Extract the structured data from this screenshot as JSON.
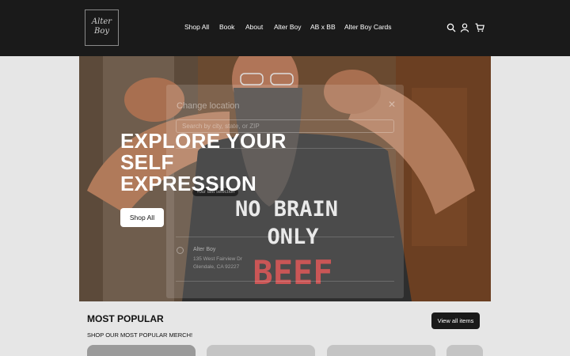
{
  "header": {
    "logo": {
      "line1": "Alter",
      "line2": "Boy"
    },
    "nav": [
      {
        "label": "Shop All"
      },
      {
        "label": "Book"
      },
      {
        "label": "About"
      },
      {
        "label": "Alter Boy"
      },
      {
        "label": "AB x BB"
      },
      {
        "label": "Alter Boy Cards"
      }
    ],
    "icons": [
      "search-icon",
      "account-icon",
      "cart-icon"
    ]
  },
  "hero": {
    "title_lines": [
      "EXPLORE YOUR",
      "SELF",
      "EXPRESSION"
    ],
    "button_label": "Shop All",
    "shirt_lines": [
      "NO BRAIN",
      "ONLY",
      "BEEF"
    ]
  },
  "modal": {
    "title": "Change location",
    "search_placeholder": "Search by city, state, or ZIP",
    "badge": "Your last selection",
    "store_name": "Alter Boy",
    "store_addr_line1": "135 West Fairview Dr",
    "store_addr_line2": "Glendale, CA 92227"
  },
  "popular": {
    "title": "MOST POPULAR",
    "subtitle": "SHOP OUR MOST POPULAR MERCH!",
    "view_all_label": "View all items"
  },
  "colors": {
    "header_bg": "#1a1a1a",
    "page_bg": "#e6e6e6",
    "shirt_red": "#c23b3b"
  }
}
